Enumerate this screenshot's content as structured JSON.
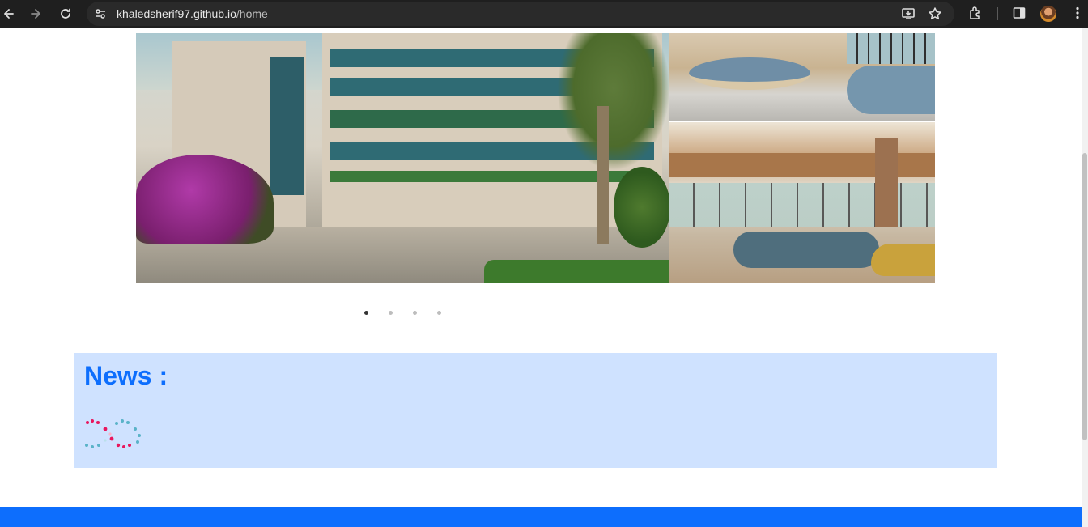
{
  "browser": {
    "url_host": "khaledsherif97.github.io",
    "url_path": "/home",
    "icons": [
      "back-icon",
      "forward-icon",
      "reload-icon",
      "site-settings-icon",
      "install-app-icon",
      "bookmark-star-icon",
      "extensions-icon",
      "side-panel-icon",
      "profile-avatar",
      "kebab-menu-icon"
    ]
  },
  "carousel": {
    "slides": 4,
    "active_index": 0,
    "images": [
      "hospital-building-exterior",
      "lobby-seating-area",
      "lobby-lounge-interior"
    ]
  },
  "news": {
    "title": "News :",
    "loading_indicator": "dot-infinity-loader"
  },
  "colors": {
    "accent": "#0d6efd",
    "news_background": "#cfe2ff",
    "chrome_background": "#1f1f1f",
    "loader_pink": "#e8175d",
    "loader_teal": "#5ab3c8"
  }
}
